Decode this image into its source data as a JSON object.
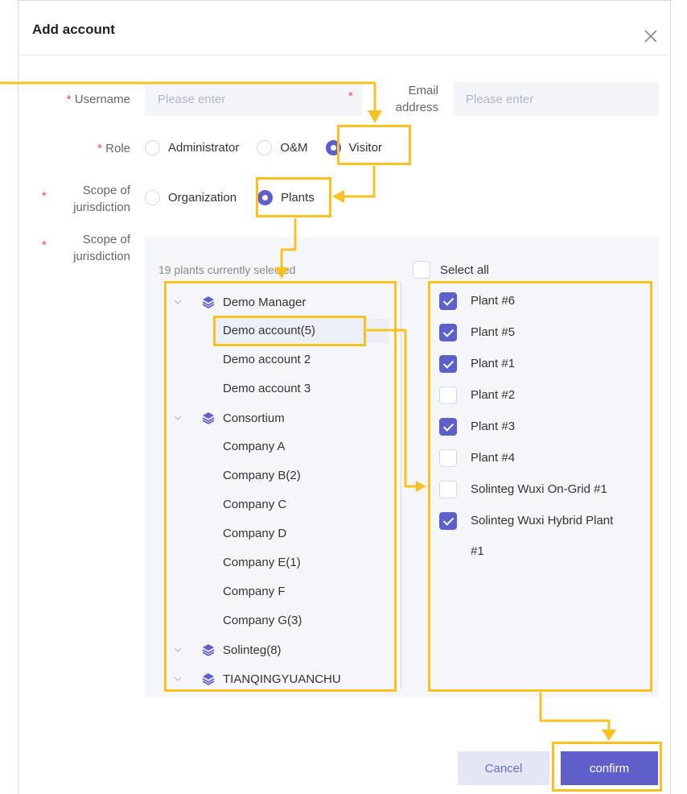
{
  "dialog": {
    "title": "Add account",
    "close_icon": "close-icon"
  },
  "form": {
    "username": {
      "required": "*",
      "label": "Username",
      "placeholder": "Please enter"
    },
    "email": {
      "required": "*",
      "label_line1": "Email",
      "label_line2": "address",
      "placeholder": "Please enter"
    },
    "role": {
      "required": "*",
      "label": "Role",
      "options": [
        {
          "label": "Administrator",
          "checked": false
        },
        {
          "label": "O&M",
          "checked": false
        },
        {
          "label": "Visitor",
          "checked": true
        }
      ]
    },
    "scope": {
      "required": "*",
      "label_line1": "Scope of",
      "label_line2": "jurisdiction",
      "options": [
        {
          "label": "Organization",
          "checked": false
        },
        {
          "label": "Plants",
          "checked": true
        }
      ]
    },
    "scope2": {
      "required": "*",
      "label_line1": "Scope of",
      "label_line2": "jurisdiction"
    }
  },
  "panel": {
    "summary": "19 plants currently selected",
    "select_all": "Select all",
    "tree": {
      "groups": [
        {
          "label": "Demo Manager",
          "children": [
            "Demo account(5)",
            "Demo account 2",
            "Demo account 3"
          ]
        },
        {
          "label": "Consortium",
          "children": [
            "Company A",
            "Company B(2)",
            "Company C",
            "Company D",
            "Company E(1)",
            "Company F",
            "Company G(3)"
          ]
        },
        {
          "label": "Solinteg(8)",
          "children": []
        },
        {
          "label": "TIANQINGYUANCHU",
          "children": []
        }
      ]
    },
    "plants": [
      {
        "label": "Plant #6",
        "checked": true
      },
      {
        "label": "Plant #5",
        "checked": true
      },
      {
        "label": "Plant #1",
        "checked": true
      },
      {
        "label": "Plant #2",
        "checked": false
      },
      {
        "label": "Plant #3",
        "checked": true
      },
      {
        "label": "Plant #4",
        "checked": false
      },
      {
        "label": "Solinteg Wuxi On-Grid #1",
        "checked": false
      },
      {
        "label": "Solinteg Wuxi Hybrid Plant",
        "label2": "#1",
        "checked": true
      }
    ]
  },
  "buttons": {
    "cancel": "Cancel",
    "confirm": "confirm"
  },
  "colors": {
    "accent": "#5f5fc9",
    "highlight": "#f9c122",
    "required": "#f0504e"
  }
}
